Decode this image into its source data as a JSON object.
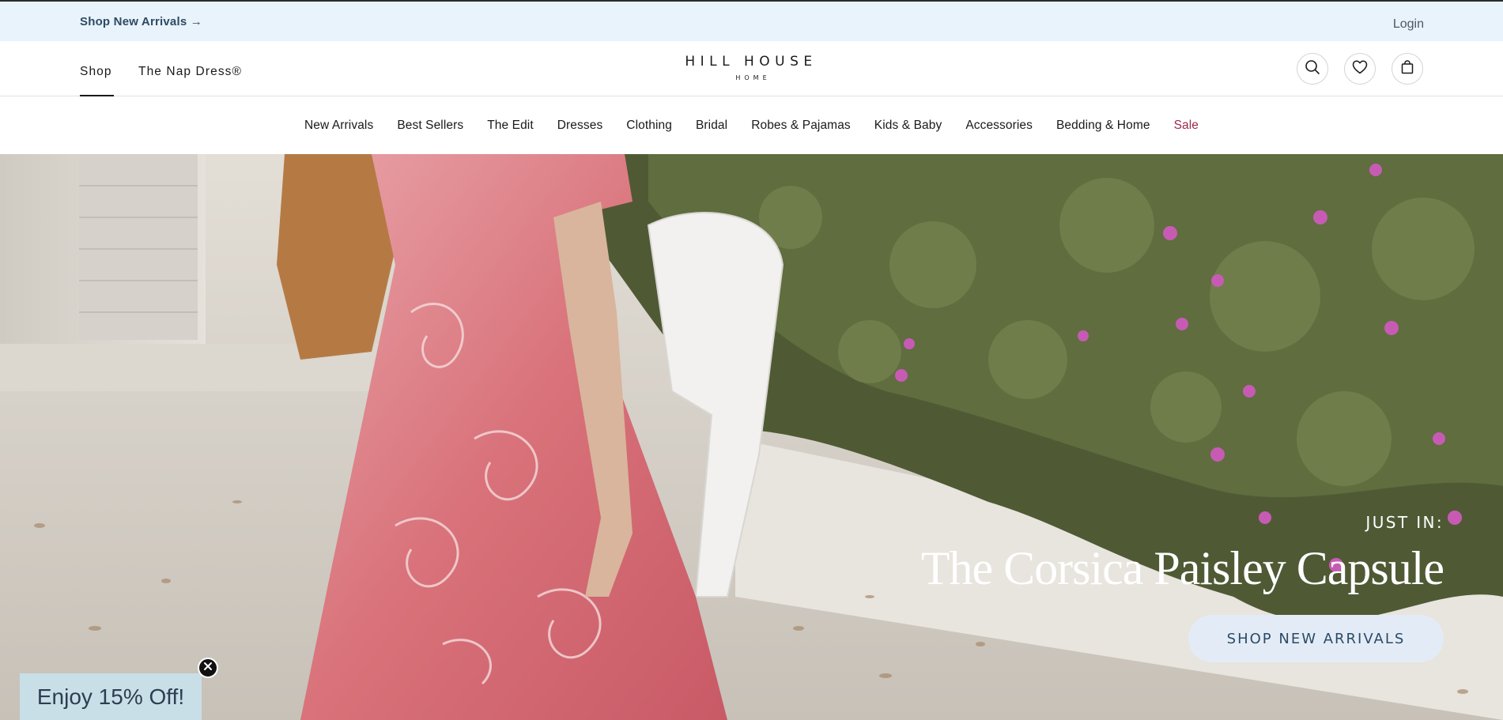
{
  "announcement": {
    "promo_label": "Shop New Arrivals →",
    "login_label": "Login"
  },
  "header": {
    "tabs": [
      {
        "label": "Shop",
        "active": true
      },
      {
        "label": "The Nap Dress®",
        "active": false
      }
    ],
    "logo_main": "HILL HOUSE",
    "logo_sub": "HOME",
    "icons": [
      "search-icon",
      "heart-icon",
      "bag-icon"
    ]
  },
  "category_nav": [
    {
      "label": "New Arrivals"
    },
    {
      "label": "Best Sellers"
    },
    {
      "label": "The Edit"
    },
    {
      "label": "Dresses"
    },
    {
      "label": "Clothing"
    },
    {
      "label": "Bridal"
    },
    {
      "label": "Robes & Pajamas"
    },
    {
      "label": "Kids & Baby"
    },
    {
      "label": "Accessories"
    },
    {
      "label": "Bedding & Home"
    },
    {
      "label": "Sale"
    }
  ],
  "hero": {
    "eyebrow": "JUST IN:",
    "headline": "The Corsica Paisley Capsule",
    "cta_label": "SHOP NEW ARRIVALS"
  },
  "discount": {
    "label": "Enjoy 15% Off!"
  },
  "colors": {
    "announcement_bg": "#e8f3fb",
    "sale": "#9b2b4b",
    "cta_bg": "#e3ecf6",
    "cta_text": "#2c4a66",
    "discount_bg": "#c9dfe8"
  }
}
